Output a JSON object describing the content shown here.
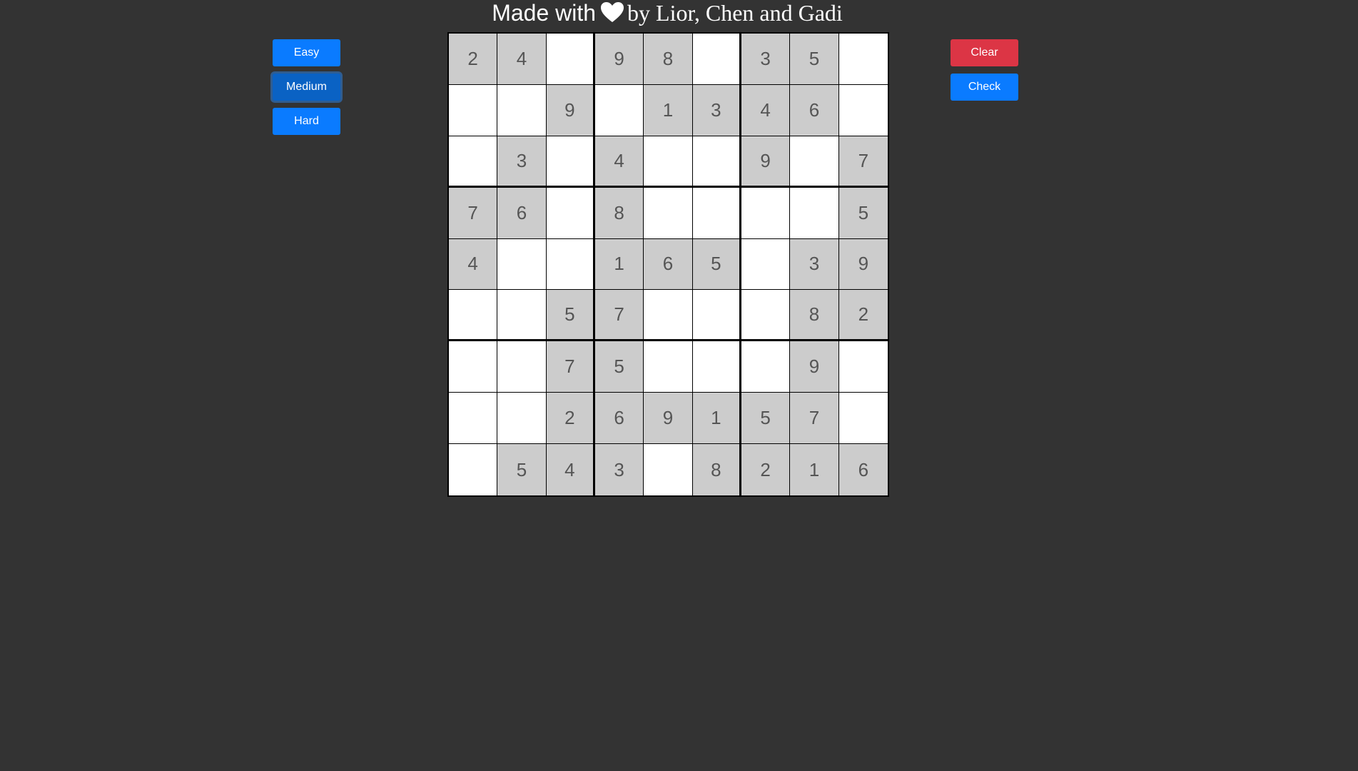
{
  "header": {
    "made_with": "Made with",
    "icon": "heart-icon",
    "by_authors": "by Lior, Chen and Gadi"
  },
  "difficulty": {
    "easy_label": "Easy",
    "medium_label": "Medium",
    "hard_label": "Hard",
    "selected": "Medium"
  },
  "actions": {
    "clear_label": "Clear",
    "check_label": "Check"
  },
  "colors": {
    "background": "#333333",
    "button_blue": "#0a7bff",
    "button_red": "#dc3545",
    "given_cell": "#cccccc",
    "empty_cell": "#ffffff"
  },
  "board": {
    "rows": [
      [
        "2",
        "4",
        "",
        "9",
        "8",
        "",
        "3",
        "5",
        ""
      ],
      [
        "",
        "",
        "9",
        "",
        "1",
        "3",
        "4",
        "6",
        ""
      ],
      [
        "",
        "3",
        "",
        "4",
        "",
        "",
        "9",
        "",
        "7"
      ],
      [
        "7",
        "6",
        "",
        "8",
        "",
        "",
        "",
        "",
        "5"
      ],
      [
        "4",
        "",
        "",
        "1",
        "6",
        "5",
        "",
        "3",
        "9"
      ],
      [
        "",
        "",
        "5",
        "7",
        "",
        "",
        "",
        "8",
        "2"
      ],
      [
        "",
        "",
        "7",
        "5",
        "",
        "",
        "",
        "9",
        ""
      ],
      [
        "",
        "",
        "2",
        "6",
        "9",
        "1",
        "5",
        "7",
        ""
      ],
      [
        "",
        "5",
        "4",
        "3",
        "",
        "8",
        "2",
        "1",
        "6"
      ]
    ]
  }
}
